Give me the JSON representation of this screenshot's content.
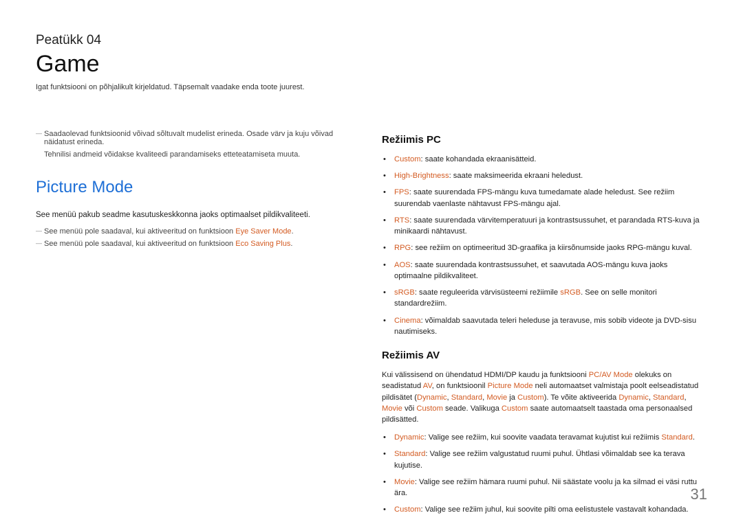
{
  "chapter": "Peatükk  04",
  "title": "Game",
  "subtitle": "Igat funktsiooni on põhjalikult kirjeldatud. Täpsemalt vaadake enda toote juurest.",
  "left": {
    "note1": "Saadaolevad funktsioonid võivad sõltuvalt mudelist erineda. Osade värv ja kuju võivad näidatust erineda.",
    "note1b": "Tehnilisi andmeid võidakse kvaliteedi parandamiseks etteteatamiseta muuta.",
    "section": "Picture Mode",
    "body": "See menüü pakub seadme kasutuskeskkonna jaoks optimaalset pildikvaliteeti.",
    "note2_pre": "See menüü pole saadaval, kui aktiveeritud on funktsioon ",
    "note2_hl": "Eye Saver Mode",
    "note3_pre": "See menüü pole saadaval, kui aktiveeritud on funktsioon ",
    "note3_hl": "Eco Saving Plus"
  },
  "right": {
    "pc_heading": "Režiimis PC",
    "pc_items": [
      {
        "hl": "Custom",
        "rest": ": saate kohandada ekraanisätteid."
      },
      {
        "hl": "High-Brightness",
        "rest": ": saate maksimeerida ekraani heledust."
      },
      {
        "hl": "FPS",
        "rest": ": saate suurendada FPS-mängu kuva tumedamate alade heledust. See režiim suurendab vaenlaste nähtavust FPS-mängu ajal."
      },
      {
        "hl": "RTS",
        "rest": ": saate suurendada värvitemperatuuri ja kontrastsussuhet, et parandada RTS-kuva ja minikaardi nähtavust."
      },
      {
        "hl": "RPG",
        "rest": ": see režiim on optimeeritud 3D-graafika ja kiirsõnumside jaoks RPG-mängu kuval."
      },
      {
        "hl": "AOS",
        "rest": ": saate suurendada kontrastsussuhet, et saavutada AOS-mängu kuva jaoks optimaalne pildikvaliteet."
      },
      {
        "hl": "sRGB",
        "rest_pre": ": saate reguleerida värvisüsteemi režiimile ",
        "hl2": "sRGB",
        "rest_post": ". See on selle monitori standardrežiim."
      },
      {
        "hl": "Cinema",
        "rest": ": võimaldab saavutada teleri heleduse ja teravuse, mis sobib videote ja DVD-sisu nautimiseks."
      }
    ],
    "av_heading": "Režiimis AV",
    "av_intro_parts": {
      "t1": "Kui välissisend on ühendatud HDMI/DP kaudu ja funktsiooni ",
      "h1": "PC/AV Mode",
      "t2": " olekuks on seadistatud ",
      "h2": "AV",
      "t3": ", on funktsioonil ",
      "h3": "Picture Mode",
      "t4": " neli automaatset valmistaja poolt eelseadistatud pildisätet (",
      "h4": "Dynamic",
      "t5": ", ",
      "h5": "Standard",
      "t6": ", ",
      "h6": "Movie",
      "t7": " ja ",
      "h7": "Custom",
      "t8": "). Te võite aktiveerida ",
      "h8": "Dynamic",
      "t9": ", ",
      "h9": "Standard",
      "t10": ", ",
      "h10": "Movie",
      "t11": " või ",
      "h11": "Custom",
      "t12": " seade. Valikuga ",
      "h12": "Custom",
      "t13": " saate automaatselt taastada oma personaalsed pildisätted."
    },
    "av_items": [
      {
        "hl": "Dynamic",
        "rest_pre": ": Valige see režiim, kui soovite vaadata teravamat kujutist kui režiimis ",
        "hl2": "Standard",
        "rest_post": "."
      },
      {
        "hl": "Standard",
        "rest": ": Valige see režiim valgustatud ruumi puhul. Ühtlasi võimaldab see ka terava kujutise."
      },
      {
        "hl": "Movie",
        "rest": ": Valige see režiim hämara ruumi puhul. Nii säästate voolu ja ka silmad ei väsi ruttu ära."
      },
      {
        "hl": "Custom",
        "rest": ": Valige see režiim juhul, kui soovite pilti oma eelistustele vastavalt kohandada."
      }
    ]
  },
  "page_number": "31"
}
